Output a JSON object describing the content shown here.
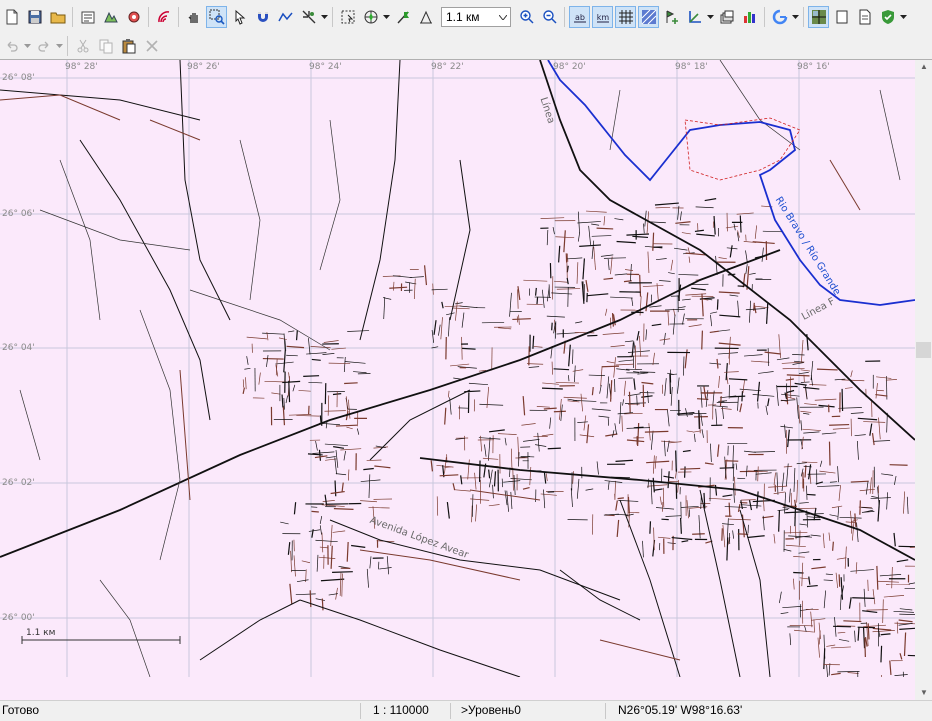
{
  "toolbar": {
    "zoom_value": "1.1 км",
    "main_buttons": [
      {
        "name": "new-file-icon"
      },
      {
        "name": "save-icon"
      },
      {
        "name": "open-folder-icon"
      },
      {
        "name": "sep"
      },
      {
        "name": "properties-icon"
      },
      {
        "name": "map-settings-icon"
      },
      {
        "name": "gps-icon"
      },
      {
        "name": "sep"
      },
      {
        "name": "signal-icon"
      },
      {
        "name": "sep"
      },
      {
        "name": "pan-hand-icon"
      },
      {
        "name": "zoom-rect-icon",
        "active": true
      },
      {
        "name": "select-arrow-icon"
      },
      {
        "name": "magnet-icon"
      },
      {
        "name": "polyline-icon"
      },
      {
        "name": "crosshair-tool-icon",
        "dropdown": true
      },
      {
        "name": "sep"
      },
      {
        "name": "select-area-icon"
      },
      {
        "name": "compass-icon",
        "dropdown": true
      },
      {
        "name": "flag-icon"
      },
      {
        "name": "measure-icon"
      }
    ],
    "view_buttons": [
      {
        "name": "zoom-in-icon"
      },
      {
        "name": "zoom-out-icon"
      },
      {
        "name": "sep"
      },
      {
        "name": "labels-ab-icon",
        "active": true,
        "text": "ab"
      },
      {
        "name": "labels-km-icon",
        "active": true,
        "text": "km"
      },
      {
        "name": "grid-icon",
        "active": true
      },
      {
        "name": "hatch-icon",
        "active": true
      },
      {
        "name": "add-waypoint-icon"
      },
      {
        "name": "coordinates-icon",
        "dropdown": true
      },
      {
        "name": "layers-icon"
      },
      {
        "name": "statistics-icon"
      },
      {
        "name": "sep"
      },
      {
        "name": "google-icon",
        "dropdown": true
      },
      {
        "name": "sep"
      },
      {
        "name": "map-tiles-icon",
        "active": true
      },
      {
        "name": "blank-page-icon"
      },
      {
        "name": "document-icon"
      },
      {
        "name": "shield-check-icon",
        "dropdown": true
      }
    ],
    "edit_buttons": [
      {
        "name": "undo-icon",
        "dropdown": true,
        "disabled": true
      },
      {
        "name": "redo-icon",
        "dropdown": true,
        "disabled": true
      },
      {
        "name": "sep"
      },
      {
        "name": "cut-icon",
        "disabled": true
      },
      {
        "name": "copy-icon",
        "disabled": true
      },
      {
        "name": "paste-icon"
      },
      {
        "name": "delete-icon",
        "disabled": true
      }
    ]
  },
  "map": {
    "lat_labels": [
      "26° 08'",
      "26° 06'",
      "26° 04'",
      "26° 02'",
      "26° 00'"
    ],
    "lon_labels": [
      "98° 28'",
      "98° 26'",
      "98° 24'",
      "98° 22'",
      "98° 20'",
      "98° 18'",
      "98° 16'"
    ],
    "scale_label": "1.1 км",
    "street_labels": [
      "Avenida López Avear",
      "Línea",
      "Línea F",
      "Rio Bravo / Río Grande"
    ],
    "colors": {
      "background": "#fbe9fb",
      "grid": "#c8c8dc",
      "road": "#111111",
      "street": "#7a3a2e",
      "river": "#1a2fd0",
      "boundary": "#d02020"
    }
  },
  "status": {
    "ready": "Готово",
    "scale": "1 : 110000",
    "level": ">Уровень0",
    "coords": "N26°05.19' W98°16.63'"
  }
}
